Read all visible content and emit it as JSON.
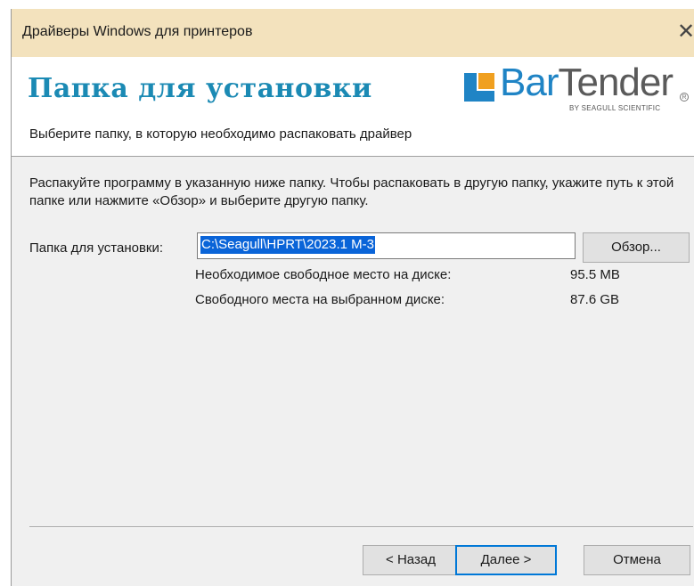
{
  "window": {
    "title": "Драйверы Windows для принтеров",
    "close_glyph": "✕"
  },
  "header": {
    "title": "Папка для установки",
    "subtitle": "Выберите папку, в которую необходимо распаковать драйвер",
    "logo": {
      "text_bar": "Bar",
      "text_tender": "Tender",
      "tagline": "BY SEAGULL SCIENTIFIC",
      "tm": "R"
    }
  },
  "body": {
    "description": "Распакуйте программу в указанную ниже папку. Чтобы распаковать в другую папку, укажите путь к этой папке или нажмите «Обзор» и выберите  другую папку.",
    "folder_label": "Папка для установки:",
    "folder_value": "C:\\Seagull\\HPRT\\2023.1 M-3",
    "browse_label": "Обзор...",
    "required_space_label": "Необходимое свободное место на диске:",
    "required_space_value": "95.5 MB",
    "available_space_label": "Свободного места на выбранном диске:",
    "available_space_value": "87.6 GB"
  },
  "footer": {
    "back_label": "< Назад",
    "next_label": "Далее >",
    "cancel_label": "Отмена"
  },
  "colors": {
    "titlebar": "#f3e2bd",
    "header_title": "#1b8ab4",
    "logo_blue": "#1f84c5",
    "selection": "#0a64d8"
  },
  "icons": {
    "close": "close-icon",
    "logo_mark": "bartender-logo-mark-icon"
  }
}
